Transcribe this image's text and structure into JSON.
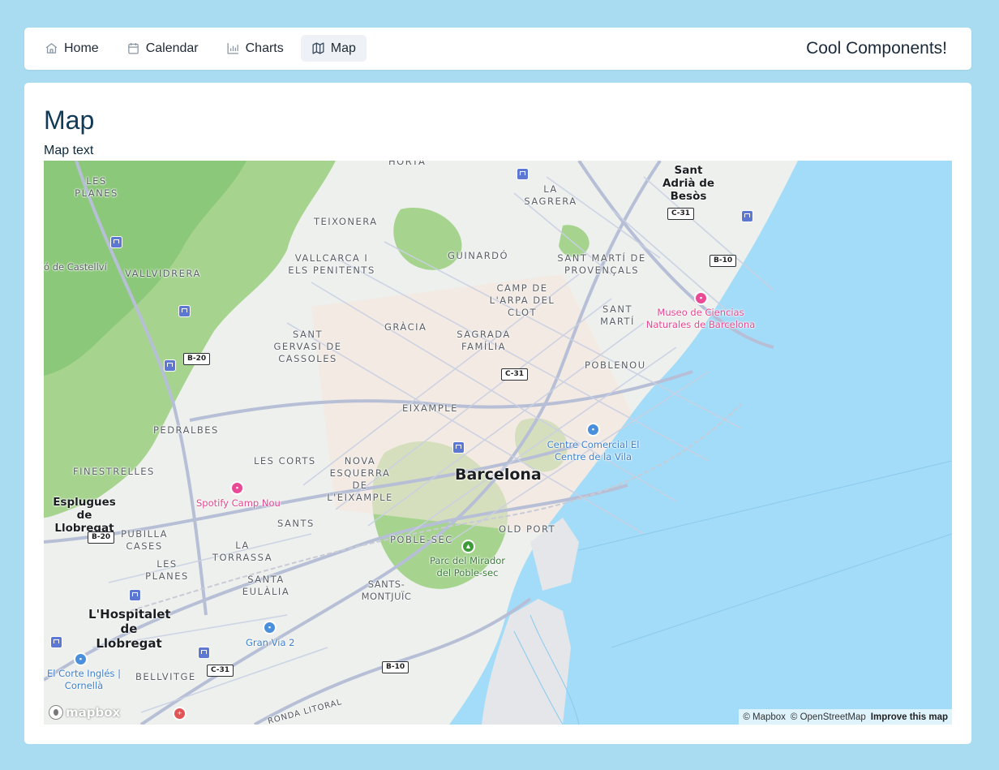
{
  "nav": {
    "items": [
      {
        "label": "Home",
        "icon": "home-icon"
      },
      {
        "label": "Calendar",
        "icon": "calendar-icon"
      },
      {
        "label": "Charts",
        "icon": "chart-bar-icon"
      },
      {
        "label": "Map",
        "icon": "map-icon",
        "active": true
      }
    ],
    "brand": "Cool Components!"
  },
  "page": {
    "title": "Map",
    "text": "Map text"
  },
  "map": {
    "colors": {
      "water": "#a3dcf8",
      "park": "#9fd48c",
      "land": "#eeefed",
      "road": "#b8c0d4"
    },
    "labels": {
      "horta": "HORTA",
      "sant_adria": "Sant Adrià de Besòs",
      "les_planes_n": "LES PLANES",
      "teixonera": "TEIXONERA",
      "la_sagrera": "LA SAGRERA",
      "castellvi": "ó de Castellví",
      "vallvidrera": "VALLVIDRERA",
      "vallcarca": "VALLCARCA I ELS PENITENTS",
      "guinardo": "GUINARDÓ",
      "sant_marti_prov": "SANT MARTÍ DE PROVENÇALS",
      "camp_arpa": "CAMP DE L'ARPA DEL CLOT",
      "sant_marti": "SANT MARTÍ",
      "gracia": "GRÀCIA",
      "sagrada_familia": "SAGRADA FAMÍLIA",
      "sant_gervasi": "SANT GERVASI DE CASSOLES",
      "poblenou": "POBLENOU",
      "eixample": "EIXAMPLE",
      "pedralbes": "PEDRALBES",
      "finestrelles": "FINESTRELLES",
      "les_corts": "LES CORTS",
      "nova_esquerra": "NOVA ESQUERRA DE L'EIXAMPLE",
      "barcelona": "Barcelona",
      "esplugues": "Esplugues de Llobregat",
      "sants": "SANTS",
      "pubilla_cases": "PUBILLA CASES",
      "poble_sec": "POBLE-SEC",
      "old_port": "OLD PORT",
      "la_torrassa": "LA TORRASSA",
      "les_planes_s": "LES PLANES",
      "santa_eulalia": "SANTA EULÀLIA",
      "sants_montjuic": "SANTS-MONTJUÏC",
      "hospitalet": "L'Hospitalet de Llobregat",
      "bellvitge": "BELLVITGE",
      "ronda_litoral": "RONDA LITORAL"
    },
    "pois": {
      "museo": "Museo de Ciencias Naturales de Barcelona",
      "centre_comercial": "Centre Comercial El Centre de la Vila",
      "spotify": "Spotify Camp Nou",
      "mirador": "Parc del Mirador del Poble-sec",
      "gran_via": "Gran Via 2",
      "corte_ingles": "El Corte Inglés | Cornellà"
    },
    "shields": {
      "c31_north": "C-31",
      "b10_north": "B-10",
      "b20_west": "B-20",
      "c31_center": "C-31",
      "b20_south": "B-20",
      "c31_south": "C-31",
      "b10_south": "B-10"
    },
    "logo": "mapbox",
    "attribution": {
      "mapbox": "© Mapbox",
      "osm": "© OpenStreetMap",
      "improve": "Improve this map"
    }
  }
}
